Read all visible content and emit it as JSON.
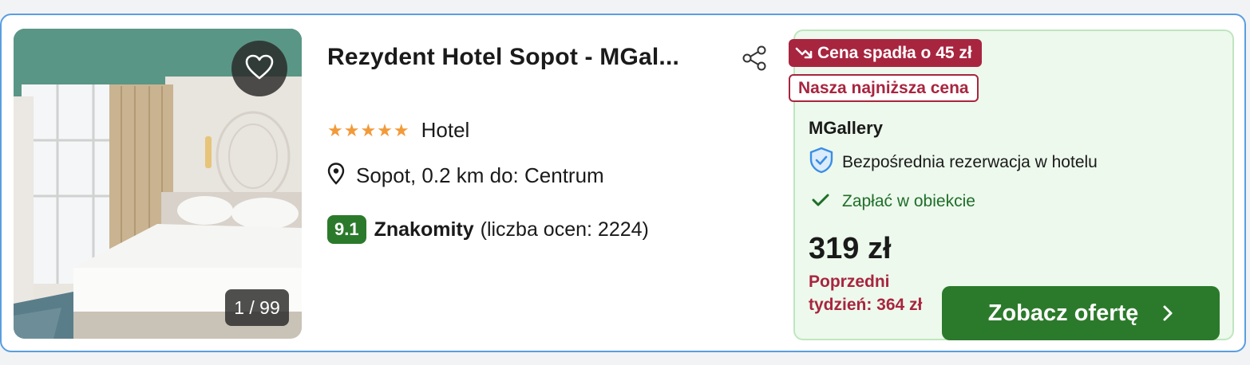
{
  "hotel": {
    "name": "Rezydent Hotel Sopot - MGal...",
    "stars": 5,
    "stars_display": "★★★★★",
    "type": "Hotel",
    "location": "Sopot, 0.2 km do: Centrum",
    "score": "9.1",
    "score_label": "Znakomity",
    "review_count": "(liczba ocen: 2224)"
  },
  "gallery": {
    "counter": "1 / 99"
  },
  "offer": {
    "price_drop": "Cena spadła o 45 zł",
    "lowest_price": "Nasza najniższa cena",
    "provider": "MGallery",
    "direct_booking": "Bezpośrednia rezerwacja w hotelu",
    "pay_at_property": "Zapłać w obiekcie",
    "price": "319 zł",
    "previous_week": "Poprzedni tydzień: 364 zł",
    "cta": "Zobacz ofertę"
  },
  "icons": {
    "favorite": "heart-icon",
    "share": "share-icon",
    "location": "map-pin-icon",
    "price_drop": "trend-down-icon",
    "direct": "shield-check-icon",
    "pay": "check-icon",
    "cta": "chevron-right-icon"
  },
  "colors": {
    "card_border": "#5a9ee0",
    "offer_bg": "#edf9ec",
    "offer_border": "#bfe6bf",
    "accent_green": "#2b7a2b",
    "accent_red": "#a8253f",
    "stars": "#f29a3a",
    "shield_blue": "#3a8ee6"
  }
}
